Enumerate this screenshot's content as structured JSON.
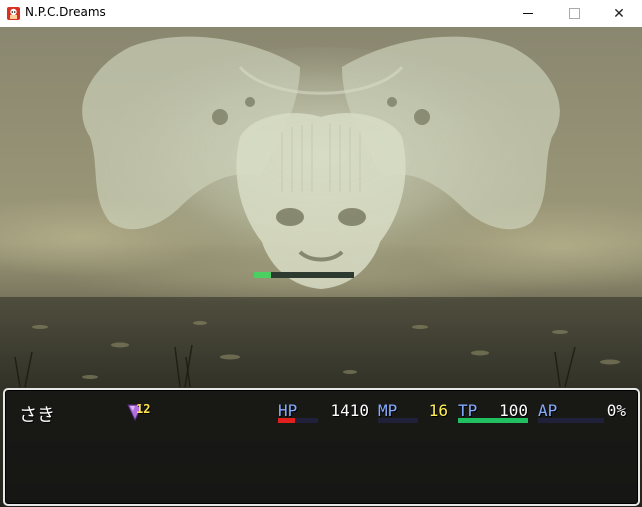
{
  "window": {
    "title": "N.P.C.Dreams",
    "controls": {
      "minimize": "minimize",
      "maximize": "maximize",
      "close": "✕"
    }
  },
  "battle": {
    "enemy_hp_fraction": 0.17
  },
  "status": {
    "actor_name": "さき",
    "state": {
      "icon": "purple-diamond-state-icon",
      "turns": "12"
    },
    "gauges": [
      {
        "key": "hp",
        "label": "HP",
        "value": "1410",
        "fraction": 0.42,
        "color": "#e0201c"
      },
      {
        "key": "mp",
        "label": "MP",
        "value": "16",
        "fraction": 0.0,
        "color": "#2050d0",
        "value_color": "#ffee55"
      },
      {
        "key": "tp",
        "label": "TP",
        "value": "100",
        "fraction": 1.0,
        "color": "#20c060"
      },
      {
        "key": "ap",
        "label": "AP",
        "value": "0%",
        "fraction": 0.0,
        "color": "#2a2aa0"
      }
    ]
  },
  "colors": {
    "label": "#84aaff",
    "hp_gauge": "#e0201c",
    "tp_gauge": "#20c060",
    "window_border": "#e8e8e8"
  }
}
